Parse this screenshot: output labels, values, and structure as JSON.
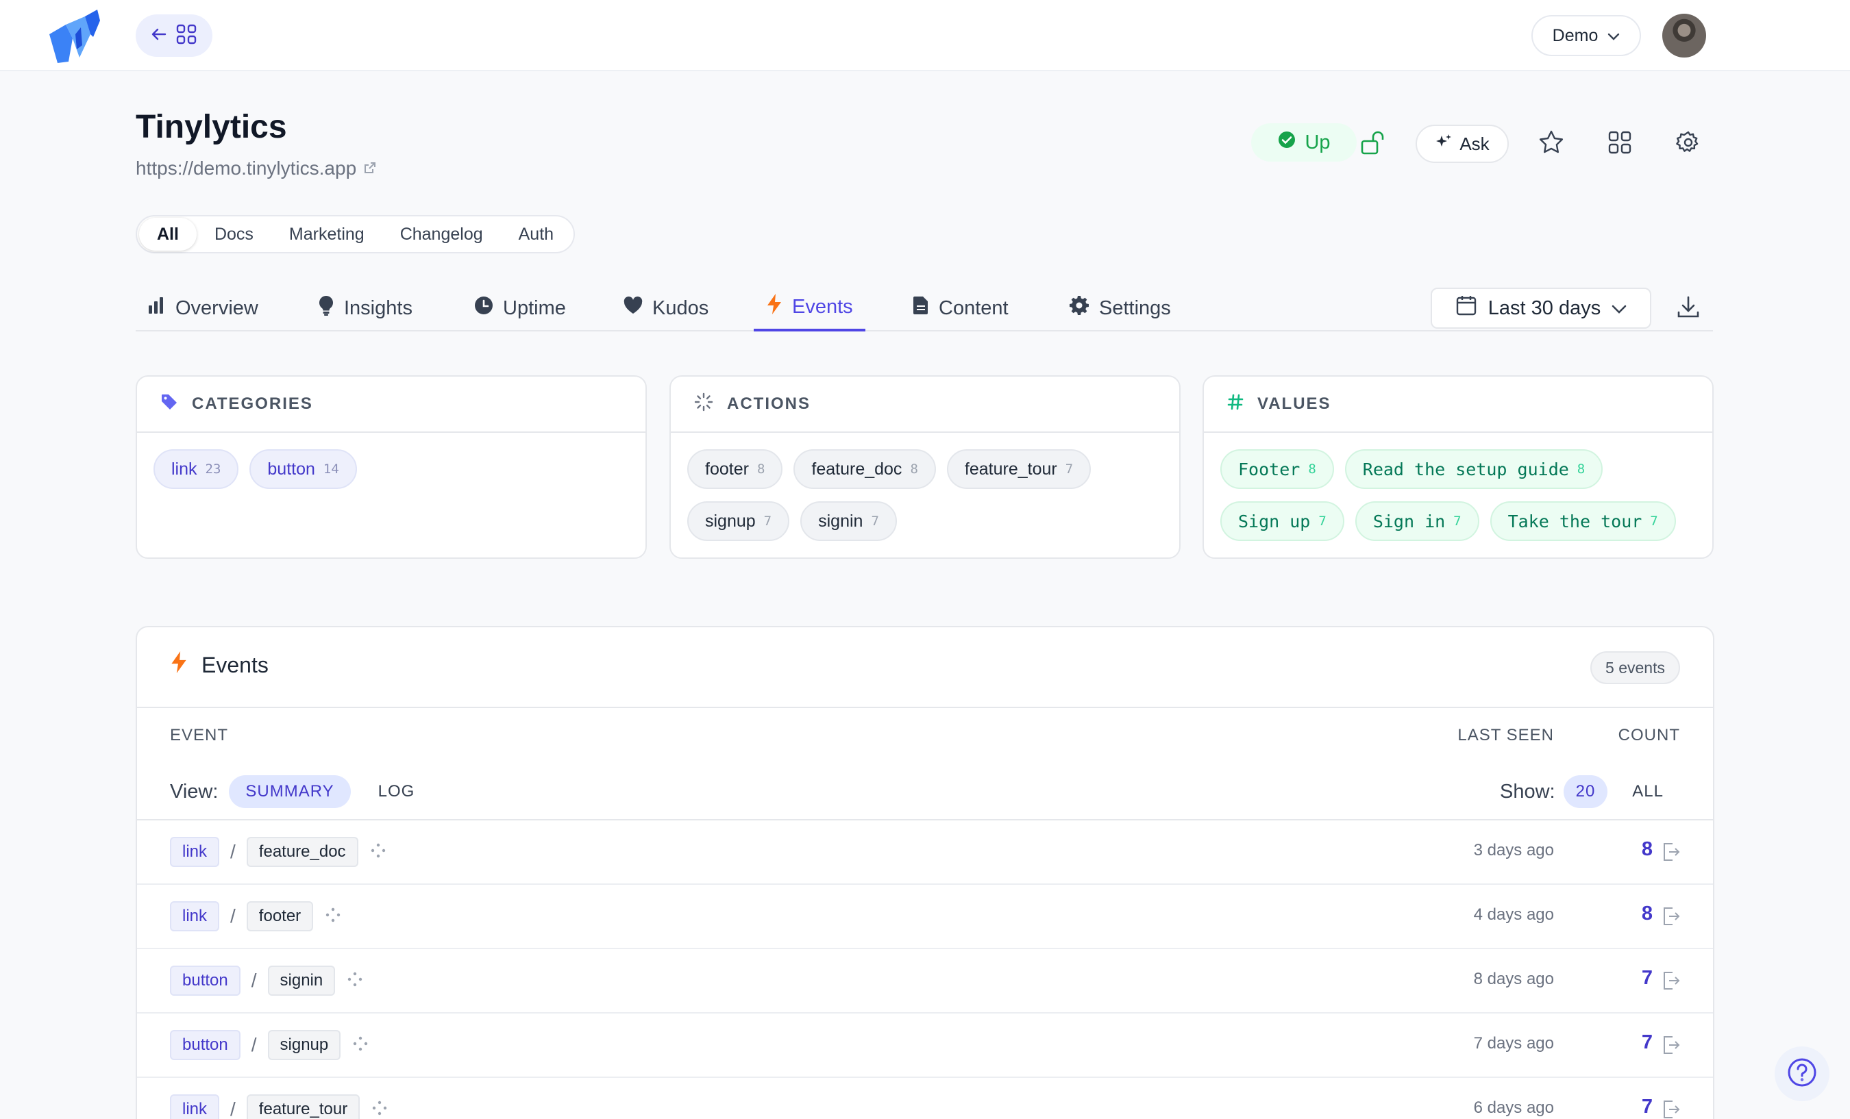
{
  "topbar": {
    "workspace": "Demo"
  },
  "site": {
    "title": "Tinylytics",
    "url": "https://demo.tinylytics.app",
    "status": "Up",
    "ask_label": "Ask"
  },
  "segments": [
    "All",
    "Docs",
    "Marketing",
    "Changelog",
    "Auth"
  ],
  "tabs": [
    {
      "label": "Overview",
      "icon": "bar-chart-icon"
    },
    {
      "label": "Insights",
      "icon": "lightbulb-icon"
    },
    {
      "label": "Uptime",
      "icon": "clock-icon"
    },
    {
      "label": "Kudos",
      "icon": "heart-icon"
    },
    {
      "label": "Events",
      "icon": "bolt-icon"
    },
    {
      "label": "Content",
      "icon": "document-icon"
    },
    {
      "label": "Settings",
      "icon": "gear-icon"
    }
  ],
  "date_range": "Last 30 days",
  "cards": {
    "categories": {
      "title": "CATEGORIES",
      "items": [
        {
          "label": "link",
          "count": "23"
        },
        {
          "label": "button",
          "count": "14"
        }
      ]
    },
    "actions": {
      "title": "ACTIONS",
      "items": [
        {
          "label": "footer",
          "count": "8"
        },
        {
          "label": "feature_doc",
          "count": "8"
        },
        {
          "label": "feature_tour",
          "count": "7"
        },
        {
          "label": "signup",
          "count": "7"
        },
        {
          "label": "signin",
          "count": "7"
        }
      ]
    },
    "values": {
      "title": "VALUES",
      "items": [
        {
          "label": "Footer",
          "count": "8"
        },
        {
          "label": "Read the setup guide",
          "count": "8"
        },
        {
          "label": "Sign up",
          "count": "7"
        },
        {
          "label": "Sign in",
          "count": "7"
        },
        {
          "label": "Take the tour",
          "count": "7"
        }
      ]
    }
  },
  "events": {
    "title": "Events",
    "total": "5 events",
    "col_event": "EVENT",
    "col_last_seen": "LAST SEEN",
    "col_count": "COUNT",
    "view_label": "View:",
    "view_summary": "SUMMARY",
    "view_log": "LOG",
    "show_label": "Show:",
    "show_20": "20",
    "show_all": "ALL",
    "rows": [
      {
        "category": "link",
        "action": "feature_doc",
        "last_seen": "3 days ago",
        "count": "8"
      },
      {
        "category": "link",
        "action": "footer",
        "last_seen": "4 days ago",
        "count": "8"
      },
      {
        "category": "button",
        "action": "signin",
        "last_seen": "8 days ago",
        "count": "7"
      },
      {
        "category": "button",
        "action": "signup",
        "last_seen": "7 days ago",
        "count": "7"
      },
      {
        "category": "link",
        "action": "feature_tour",
        "last_seen": "6 days ago",
        "count": "7"
      }
    ]
  },
  "colors": {
    "accent": "#4f46e5",
    "success": "#16a34a",
    "bolt": "#f97316"
  }
}
